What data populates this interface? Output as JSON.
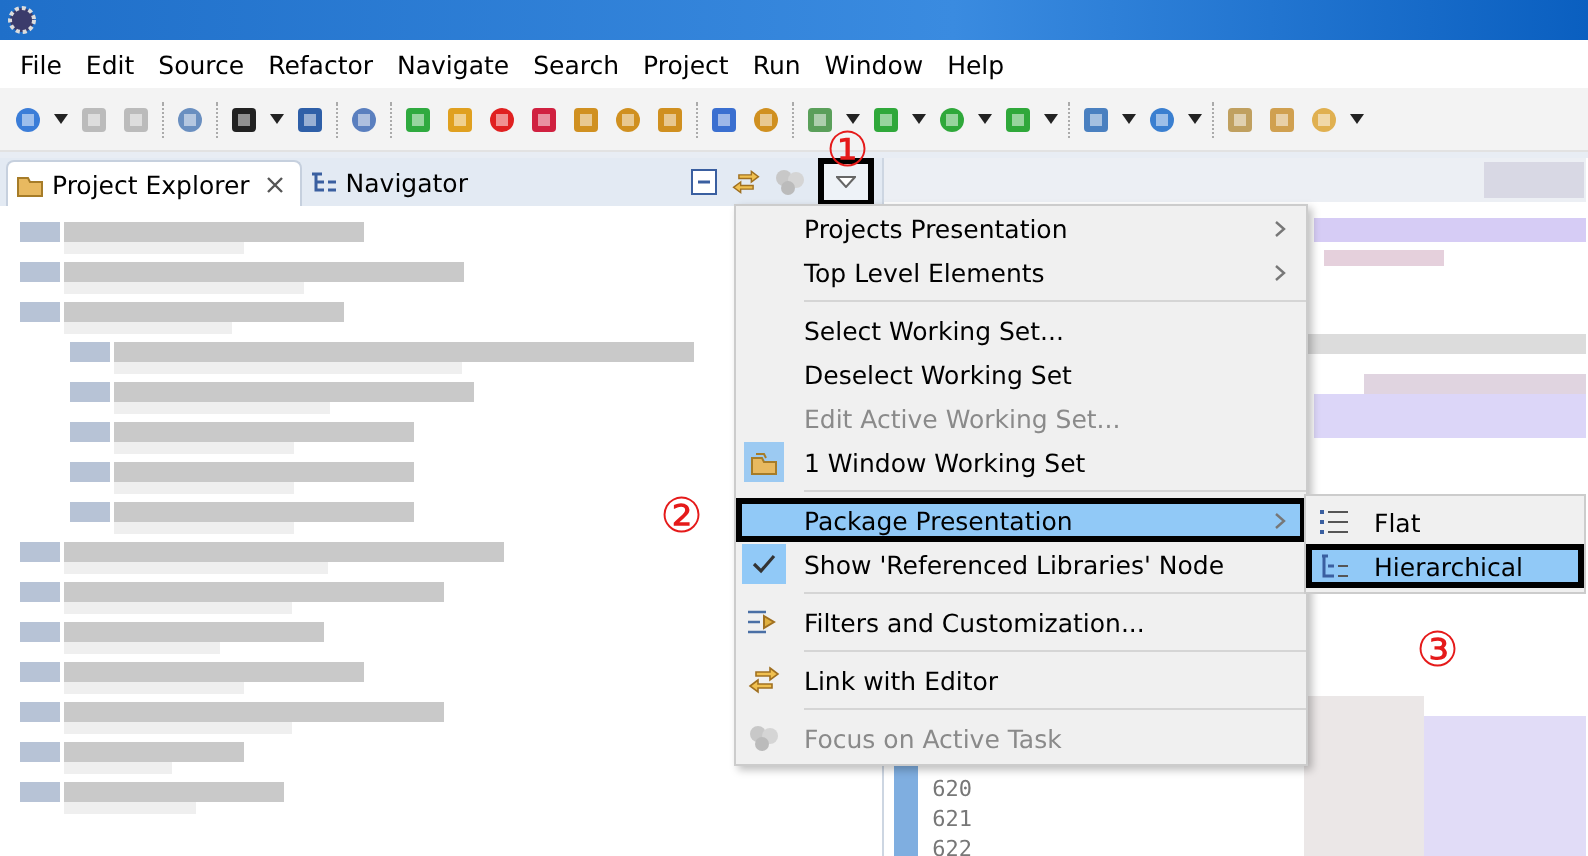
{
  "menu_bar": [
    "File",
    "Edit",
    "Source",
    "Refactor",
    "Navigate",
    "Search",
    "Project",
    "Run",
    "Window",
    "Help"
  ],
  "view_tabs": [
    {
      "label": "Project Explorer",
      "selected": true
    },
    {
      "label": "Navigator",
      "selected": false
    }
  ],
  "view_menu_button": {
    "outlined": true
  },
  "editor": {
    "line_numbers": [
      "620",
      "621",
      "622"
    ]
  },
  "view_menu": [
    {
      "kind": "item",
      "label": "Projects Presentation",
      "submenu": true,
      "disabled": false,
      "selected": false,
      "outlined": false
    },
    {
      "kind": "item",
      "label": "Top Level Elements",
      "submenu": true,
      "disabled": false,
      "selected": false,
      "outlined": false
    },
    {
      "kind": "separator"
    },
    {
      "kind": "item",
      "label": "Select Working Set...",
      "submenu": false,
      "disabled": false,
      "selected": false,
      "outlined": false
    },
    {
      "kind": "item",
      "label": "Deselect Working Set",
      "submenu": false,
      "disabled": false,
      "selected": false,
      "outlined": false
    },
    {
      "kind": "item",
      "label": "Edit Active Working Set...",
      "submenu": false,
      "disabled": true,
      "selected": false,
      "outlined": false
    },
    {
      "kind": "item",
      "label": "1 Window Working Set",
      "submenu": false,
      "disabled": false,
      "selected": false,
      "outlined": false
    },
    {
      "kind": "separator"
    },
    {
      "kind": "item",
      "label": "Package Presentation",
      "submenu": true,
      "disabled": false,
      "selected": true,
      "outlined": true
    },
    {
      "kind": "item",
      "label": "Show 'Referenced Libraries' Node",
      "submenu": false,
      "disabled": false,
      "selected": false,
      "outlined": false,
      "checked": true
    },
    {
      "kind": "separator"
    },
    {
      "kind": "item",
      "label": "Filters and Customization...",
      "submenu": false,
      "disabled": false,
      "selected": false,
      "outlined": false
    },
    {
      "kind": "separator"
    },
    {
      "kind": "item",
      "label": "Link with Editor",
      "submenu": false,
      "disabled": false,
      "selected": false,
      "outlined": false
    },
    {
      "kind": "separator"
    },
    {
      "kind": "item",
      "label": "Focus on Active Task",
      "submenu": false,
      "disabled": true,
      "selected": false,
      "outlined": false
    }
  ],
  "submenu": [
    {
      "label": "Flat",
      "selected": false,
      "outlined": false
    },
    {
      "label": "Hierarchical",
      "selected": true,
      "outlined": true
    }
  ],
  "annotations": [
    {
      "label": "①"
    },
    {
      "label": "②"
    },
    {
      "label": "③"
    }
  ]
}
